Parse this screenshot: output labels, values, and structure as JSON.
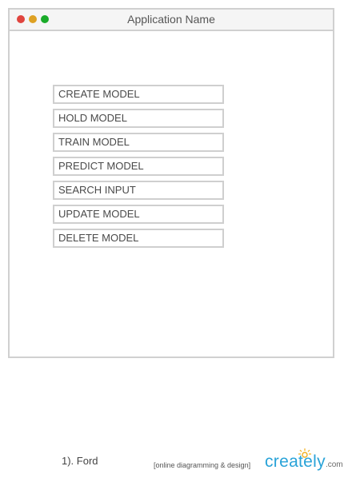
{
  "window": {
    "title": "Application Name",
    "controls": [
      {
        "name": "close",
        "color": "#e0443e"
      },
      {
        "name": "minimize",
        "color": "#dea123"
      },
      {
        "name": "maximize",
        "color": "#1aab29"
      }
    ]
  },
  "menu": {
    "items": [
      {
        "label": "CREATE MODEL"
      },
      {
        "label": "HOLD MODEL"
      },
      {
        "label": "TRAIN MODEL"
      },
      {
        "label": "PREDICT MODEL"
      },
      {
        "label": "SEARCH INPUT"
      },
      {
        "label": "UPDATE MODEL"
      },
      {
        "label": "DELETE MODEL"
      }
    ]
  },
  "footer": {
    "note": "1). Ford",
    "tagline": "[online diagramming & design]",
    "brand": "creately",
    "brand_tld": ".com",
    "brand_color": "#29a3d8"
  }
}
